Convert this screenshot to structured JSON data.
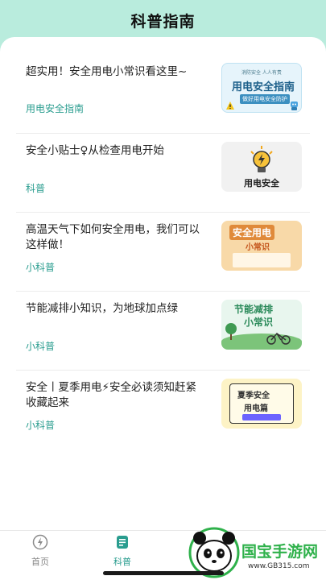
{
  "header": {
    "title": "科普指南"
  },
  "articles": [
    {
      "title": "超实用！安全用电小常识看这里~",
      "tag": "用电安全指南",
      "thumb": {
        "small": "消防安全 人人有责",
        "main": "用电安全指南",
        "sub": "做好用电安全防护"
      }
    },
    {
      "title": "安全小贴士♀从检查用电开始",
      "tag": "科普",
      "thumb": {
        "main": "用电安全"
      }
    },
    {
      "title": "高温天气下如何安全用电，我们可以这样做！",
      "tag": "小科普",
      "thumb": {
        "main": "安全用电",
        "sub": "小常识"
      }
    },
    {
      "title": "节能减排小知识，为地球加点绿",
      "tag": "小科普",
      "thumb": {
        "main": "节能减排",
        "sub": "小常识"
      }
    },
    {
      "title": "安全丨夏季用电⚡安全必读须知赶紧收藏起来",
      "tag": "小科普",
      "thumb": {
        "main": "夏季安全",
        "sub": "用电篇"
      }
    }
  ],
  "tabbar": {
    "tabs": [
      {
        "label": "首页"
      },
      {
        "label": "科普"
      }
    ]
  },
  "watermark": {
    "brand": "国宝手游网",
    "url": "www.GB315.com"
  },
  "colors": {
    "accent": "#2a9d8f",
    "header_bg": "#b9ecdd"
  }
}
